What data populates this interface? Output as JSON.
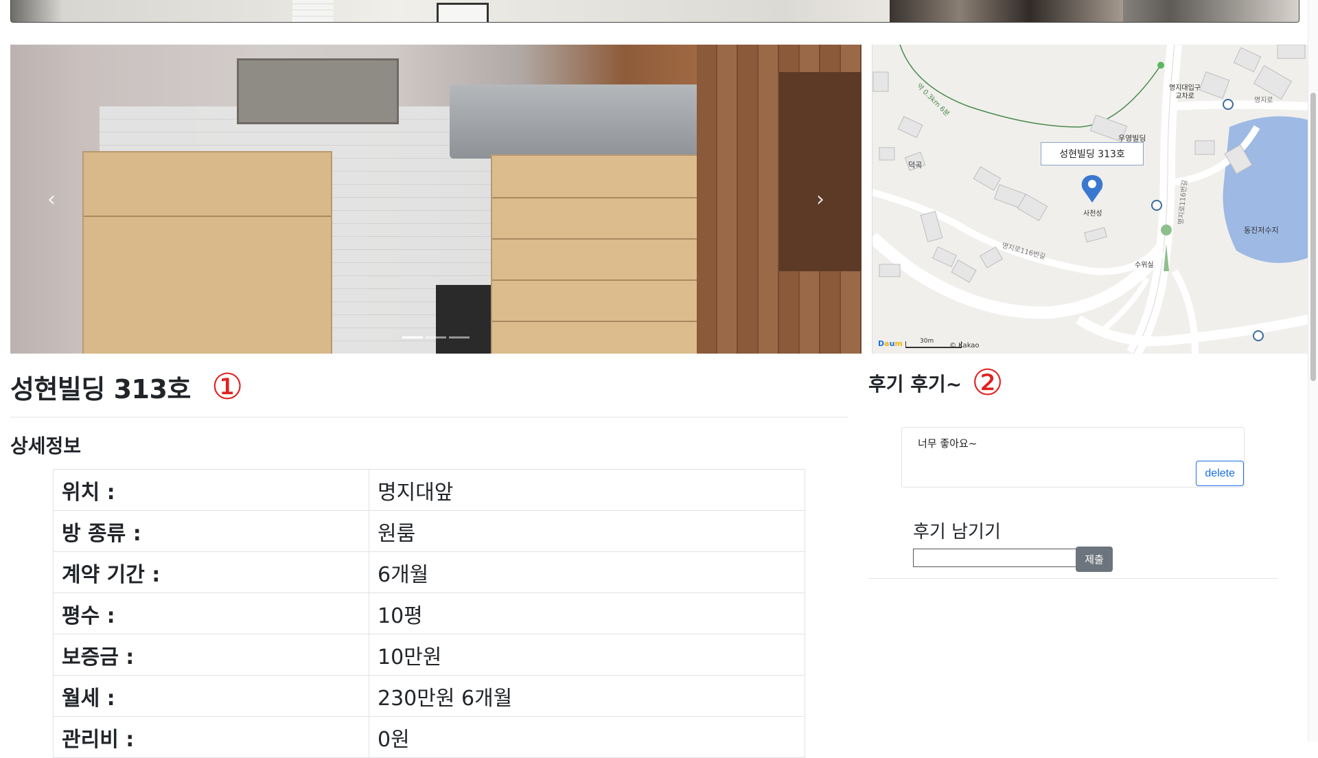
{
  "carousel": {
    "prev_icon": "chevron-left-icon",
    "next_icon": "chevron-right-icon",
    "prev_glyph": "‹",
    "next_glyph": "›",
    "slide_count": 3,
    "active_slide": 1
  },
  "map": {
    "marker_label": "성현빌딩 313호",
    "place_labels": {
      "junction": "명지대입구\n교차로",
      "woo": "우영빌딩",
      "deok": "덕곡",
      "sacheon": "사천성",
      "reservoir": "동진저수지",
      "suwi": "수위실",
      "road1": "명지로116번길",
      "road2": "명지로116번길",
      "road3": "명지로",
      "trail": "약 0.3km 6분"
    },
    "scale_label": "30m",
    "copyright": "© Kakao",
    "brand": "Daum"
  },
  "room": {
    "title": "성현빌딩 313호",
    "marker1": "①"
  },
  "detail": {
    "section_title": "상세정보",
    "rows": [
      {
        "key": "위치 :",
        "value": "명지대앞"
      },
      {
        "key": "방 종류 :",
        "value": "원룸"
      },
      {
        "key": "계약 기간 :",
        "value": "6개월"
      },
      {
        "key": "평수 :",
        "value": "10평"
      },
      {
        "key": "보증금 :",
        "value": "10만원"
      },
      {
        "key": "월세 :",
        "value": "230만원 6개월"
      },
      {
        "key": "관리비 :",
        "value": "0원"
      }
    ]
  },
  "reviews": {
    "title": "후기 후기~",
    "marker2": "②",
    "items": [
      {
        "text": "너무 좋아요~",
        "delete_label": "delete"
      }
    ],
    "write_title": "후기 남기기",
    "input_value": "",
    "input_placeholder": "",
    "submit_label": "제출"
  },
  "colors": {
    "accent": "#1a6ee6",
    "marker_red": "#e02020",
    "submit_gray": "#6c757d"
  }
}
